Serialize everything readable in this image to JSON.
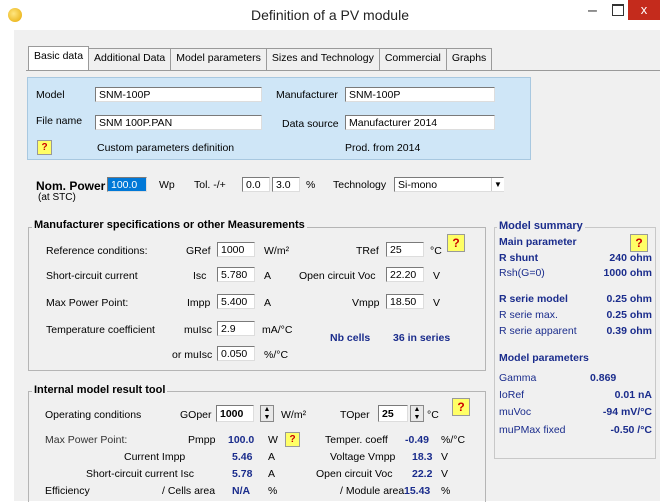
{
  "window": {
    "title": "Definition of a PV module",
    "minimize": "–",
    "close": "x"
  },
  "tabs": [
    "Basic data",
    "Additional Data",
    "Model parameters",
    "Sizes and Technology",
    "Commercial",
    "Graphs"
  ],
  "basic": {
    "model_label": "Model",
    "model_value": "SNM-100P",
    "manufacturer_label": "Manufacturer",
    "manufacturer_value": "SNM-100P",
    "filename_label": "File name",
    "filename_value": "SNM 100P.PAN",
    "datasource_label": "Data source",
    "datasource_value": "Manufacturer 2014",
    "custom_label": "Custom parameters definition",
    "prod_label": "Prod. from 2014"
  },
  "nominal": {
    "label": "Nom. Power",
    "sub": "(at STC)",
    "value": "100.0",
    "unit": "Wp",
    "tol_label": "Tol. -/+",
    "tol_minus": "0.0",
    "tol_plus": "3.0",
    "tol_unit": "%",
    "tech_label": "Technology",
    "tech_value": "Si-mono"
  },
  "specs": {
    "title": "Manufacturer specifications  or  other Measurements",
    "ref_label": "Reference conditions:",
    "gref_label": "GRef",
    "gref_value": "1000",
    "gref_unit": "W/m²",
    "tref_label": "TRef",
    "tref_value": "25",
    "tref_unit": "°C",
    "isc_row": "Short-circuit current",
    "isc_label": "Isc",
    "isc_value": "5.780",
    "isc_unit": "A",
    "voc_label": "Open circuit Voc",
    "voc_value": "22.20",
    "voc_unit": "V",
    "mpp_row": "Max Power Point:",
    "impp_label": "Impp",
    "impp_value": "5.400",
    "impp_unit": "A",
    "vmpp_label": "Vmpp",
    "vmpp_value": "18.50",
    "vmpp_unit": "V",
    "temp_row": "Temperature coefficient",
    "muisc_label": "muIsc",
    "muisc_value": "2.9",
    "muisc_unit": "mA/°C",
    "nbcells_label": "Nb cells",
    "nbcells_value": "36 in series",
    "ormuisc_label": "or muIsc",
    "ormuisc_value": "0.050",
    "ormuisc_unit": "%/°C"
  },
  "summary": {
    "title": "Model summary",
    "main_param": "Main parameter",
    "rshunt_label": "R shunt",
    "rshunt_value": "240 ohm",
    "rsh0_label": "Rsh(G=0)",
    "rsh0_value": "1000 ohm",
    "rserie_label": "R serie model",
    "rserie_value": "0.25 ohm",
    "rseriemax_label": "R serie max.",
    "rseriemax_value": "0.25 ohm",
    "rserieapp_label": "R serie apparent",
    "rserieapp_value": "0.39 ohm",
    "model_params": "Model parameters",
    "gamma_label": "Gamma",
    "gamma_value": "0.869",
    "ioref_label": "IoRef",
    "ioref_value": "0.01 nA",
    "muvoc_label": "muVoc",
    "muvoc_value": "-94 mV/°C",
    "mupmax_label": "muPMax fixed",
    "mupmax_value": "-0.50 /°C"
  },
  "tool": {
    "title": "Internal model result tool",
    "opcond_label": "Operating conditions",
    "goper_label": "GOper",
    "goper_value": "1000",
    "goper_unit": "W/m²",
    "toper_label": "TOper",
    "toper_value": "25",
    "toper_unit": "°C",
    "mpp_label": "Max Power Point:",
    "pmpp_label": "Pmpp",
    "pmpp_value": "100.0",
    "pmpp_unit": "W",
    "tempercoeff_label": "Temper. coeff",
    "tempercoeff_value": "-0.49",
    "tempercoeff_unit": "%/°C",
    "curimpp_label": "Current Impp",
    "curimpp_value": "5.46",
    "curimpp_unit": "A",
    "volvmpp_label": "Voltage Vmpp",
    "volvmpp_value": "18.3",
    "volvmpp_unit": "V",
    "scisc_label": "Short-circuit current Isc",
    "scisc_value": "5.78",
    "scisc_unit": "A",
    "ocvoc_label": "Open circuit Voc",
    "ocvoc_value": "22.2",
    "ocvoc_unit": "V",
    "eff_label": "Efficiency",
    "cellsarea_label": "/ Cells area",
    "cellsarea_value": "N/A",
    "cellsarea_unit": "%",
    "modarea_label": "/ Module area",
    "modarea_value": "15.43",
    "modarea_unit": "%"
  },
  "help_glyph": "?",
  "colors": {
    "accent_blue": "#1a2c8c",
    "info_panel": "#cfe6f7",
    "close_red": "#c42b1c"
  }
}
